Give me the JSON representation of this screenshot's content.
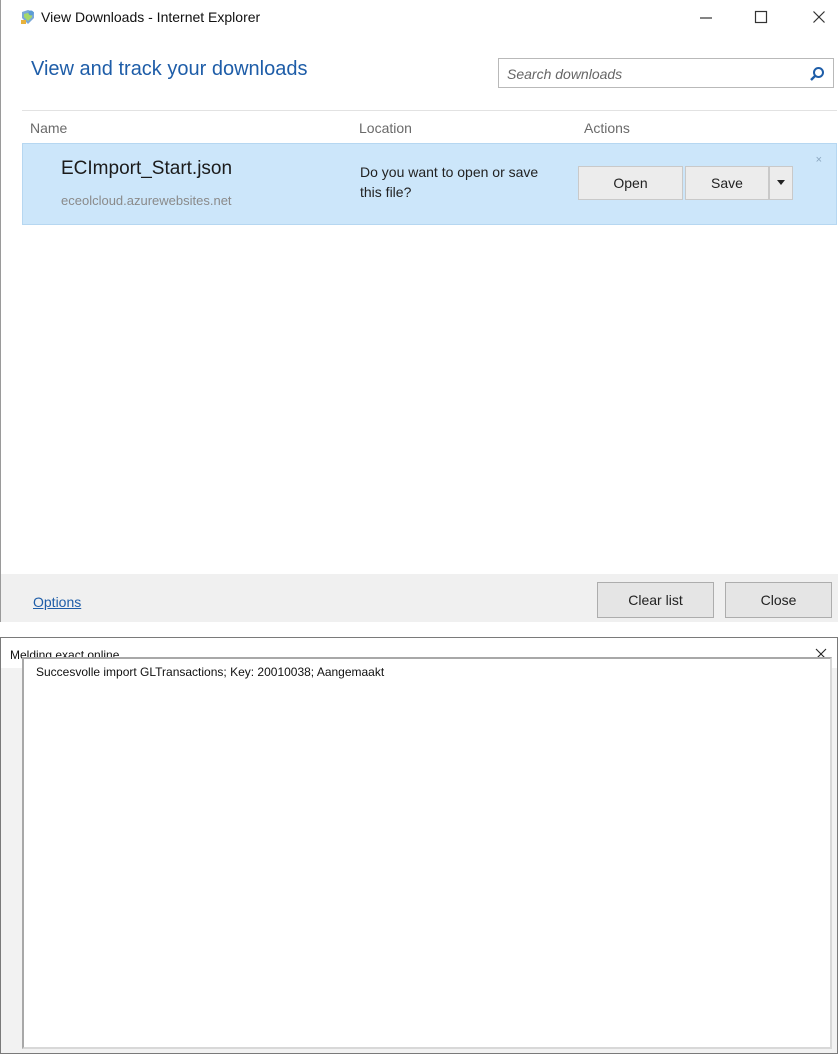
{
  "downloads_window": {
    "title": "View Downloads - Internet Explorer",
    "heading": "View and track your downloads",
    "search": {
      "placeholder": "Search downloads",
      "value": ""
    },
    "columns": {
      "name": "Name",
      "location": "Location",
      "actions": "Actions"
    },
    "items": [
      {
        "filename": "ECImport_Start.json",
        "source": "eceolcloud.azurewebsites.net",
        "prompt": "Do you want to open or save this file?",
        "open_label": "Open",
        "save_label": "Save",
        "dismiss": "×"
      }
    ],
    "footer": {
      "options_label": "Options",
      "clear_list_label": "Clear list",
      "close_label": "Close"
    },
    "colors": {
      "accent": "#1e5da8",
      "row_highlight": "#cce6fa",
      "footer_bg": "#f0f0f0"
    }
  },
  "message_window": {
    "title": "Melding exact online",
    "message": "Succesvolle import GLTransactions; Key: 20010038; Aangemaakt"
  }
}
